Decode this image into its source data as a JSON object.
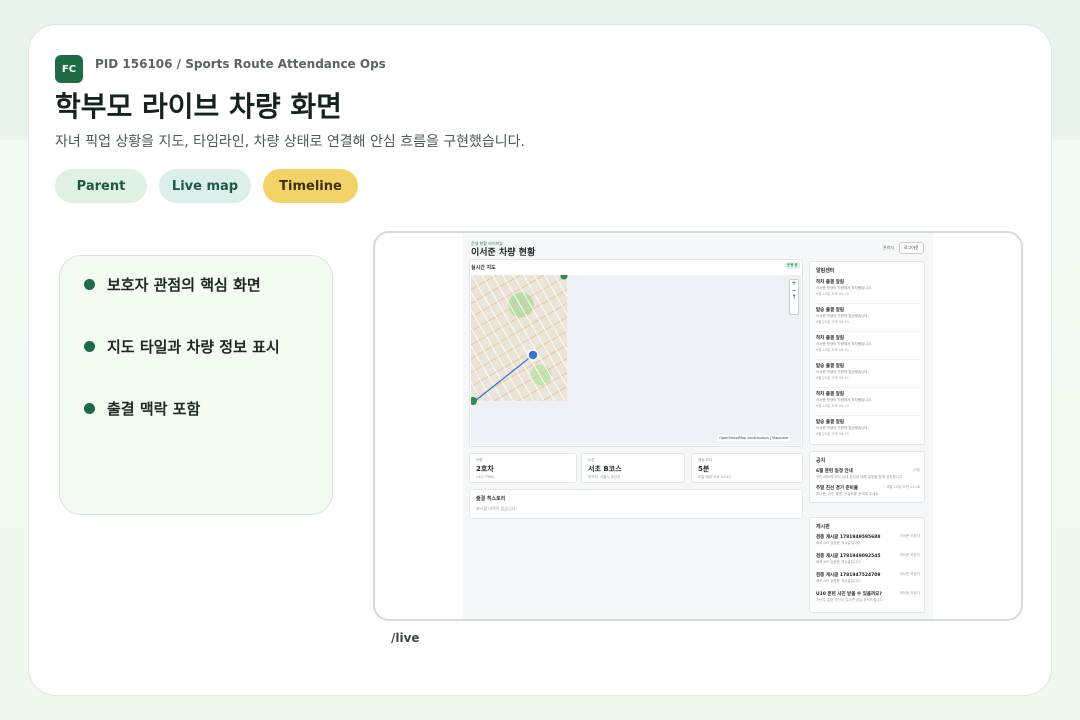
{
  "header": {
    "logo_text": "FC",
    "pid_line": "PID 156106 / Sports Route Attendance Ops",
    "title": "학부모 라이브 차량 화면",
    "subtitle": "자녀 픽업 상황을 지도, 타임라인, 차량 상태로 연결해 안심 흐름을 구현했습니다."
  },
  "tags": [
    "Parent",
    "Live map",
    "Timeline"
  ],
  "features": [
    "보호자 관점의 핵심 화면",
    "지도 타일과 차량 정보 표시",
    "출결 맥락 포함"
  ],
  "route": "/live",
  "screen": {
    "kicker": "운영 현황 라이브뷰",
    "title": "이서준 차량 현황",
    "admin_label": "관리자",
    "logout_label": "로그아웃",
    "map_label": "실시간 지도",
    "map_badge": "운행 중",
    "zoom_in": "+",
    "zoom_out": "−",
    "zoom_reset": "↑",
    "attribution": "OpenStreetMap contributors | MapLibre",
    "cards": [
      {
        "key": "차량",
        "value": "2호차",
        "detail": "24나 7988"
      },
      {
        "key": "노선",
        "value": "서초 B코스",
        "detail": "하차지: 서울시 훈련장"
      },
      {
        "key": "예상 도착",
        "value": "5분",
        "detail": "오늘 예정 오후 04:40"
      }
    ],
    "history": {
      "title": "출결 히스토리",
      "empty": "표시할 내역이 없습니다."
    },
    "alerts": {
      "title": "알림센터",
      "items": [
        {
          "title": "하차 출결 알림",
          "msg": "이서준 학생이 차량에서 하차했습니다.",
          "time": "6월 20일 오후 08:59"
        },
        {
          "title": "탑승 출결 알림",
          "msg": "이서준 학생이 차량에 탑승했습니다.",
          "time": "6월 20일 오후 08:59"
        },
        {
          "title": "하차 출결 알림",
          "msg": "이서준 학생이 차량에서 하차했습니다.",
          "time": "6월 20일 오후 08:51"
        },
        {
          "title": "탑승 출결 알림",
          "msg": "이서준 학생이 차량에 탑승했습니다.",
          "time": "6월 20일 오후 08:51"
        },
        {
          "title": "하차 출결 알림",
          "msg": "이서준 학생이 차량에서 하차했습니다.",
          "time": "6월 20일 오후 08:25"
        },
        {
          "title": "탑승 출결 알림",
          "msg": "이서준 학생이 차량에 탑승했습니다.",
          "time": "6월 20일 오후 08:25"
        }
      ]
    },
    "notices": {
      "title": "공지",
      "items": [
        {
          "title": "6월 훈련 일정 안내",
          "msg": "장마 예보에 따라 실내 훈련장 대체 일정을 함께 공지합니다.",
          "right": "고정"
        },
        {
          "title": "주말 친선 경기 준비물",
          "msg": "유니폼, 개인 물병, 풋살화를 준비해 주세요.",
          "right": "6월 20일 오전 11:08"
        }
      ]
    },
    "board": {
      "title": "게시판",
      "items": [
        {
          "title": "검증 게시글 1781949595688",
          "msg": "배포 API 검증용 게시글입니다.",
          "right": "이서준 보호자"
        },
        {
          "title": "검증 게시글 1781949092545",
          "msg": "배포 API 검증용 게시글입니다.",
          "right": "이서준 보호자"
        },
        {
          "title": "검증 게시글 1781947524709",
          "msg": "배포 API 검증용 게시글입니다.",
          "right": "이서준 보호자"
        },
        {
          "title": "U10 훈련 사진 받을 수 있을까요?",
          "msg": "지난주 훈련 사진이 있으면 공유 부탁드립니다.",
          "right": "최하윤 보호자"
        }
      ]
    }
  },
  "colors": {
    "brand": "#1f6b45",
    "accent_yellow": "#f3d368",
    "vehicle_blue": "#3b6fd8"
  }
}
